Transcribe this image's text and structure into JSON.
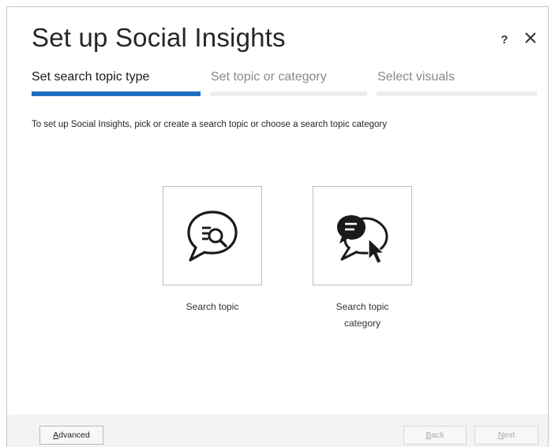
{
  "dialog": {
    "title": "Set up Social Insights",
    "help_label": "?",
    "close_icon": "close-icon"
  },
  "steps": [
    {
      "label": "Set search topic type",
      "state": "active"
    },
    {
      "label": "Set topic or category",
      "state": "inactive"
    },
    {
      "label": "Select visuals",
      "state": "inactive"
    }
  ],
  "instruction": "To set up Social Insights, pick or create a search topic or choose a search topic category",
  "tiles": [
    {
      "label": "Search topic",
      "icon": "search-topic-icon"
    },
    {
      "label_line1": "Search topic",
      "label_line2": "category",
      "icon": "search-topic-category-icon"
    }
  ],
  "footer": {
    "advanced": {
      "mnemonic": "A",
      "rest": "dvanced"
    },
    "back": {
      "mnemonic": "B",
      "rest": "ack",
      "enabled": false
    },
    "next": {
      "mnemonic": "N",
      "rest": "ext",
      "enabled": false
    }
  },
  "colors": {
    "accent": "#1f6fc0",
    "footer_bg": "#f3f3f3"
  }
}
